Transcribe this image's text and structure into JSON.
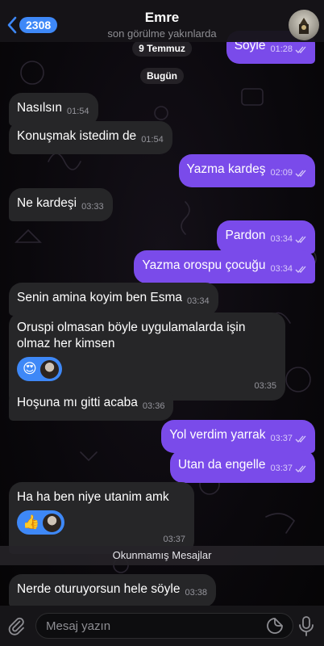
{
  "header": {
    "back_count": "2308",
    "title": "Emre",
    "subtitle": "son görülme yakınlarda"
  },
  "top_partial": {
    "date": "9 Temmuz",
    "text": "Söyle",
    "time": "01:28"
  },
  "date_today": "Bugün",
  "messages": [
    {
      "dir": "in",
      "text": "Nasılsın",
      "time": "01:54"
    },
    {
      "dir": "in",
      "text": "Konuşmak istedim de",
      "time": "01:54"
    },
    {
      "dir": "out",
      "text": "Yazma kardeş",
      "time": "02:09"
    },
    {
      "dir": "in",
      "text": "Ne kardeşi",
      "time": "03:33"
    },
    {
      "dir": "out",
      "text": "Pardon",
      "time": "03:34"
    },
    {
      "dir": "out",
      "text": "Yazma orospu çocuğu",
      "time": "03:34"
    },
    {
      "dir": "in",
      "text": "Senin amina koyim ben Esma",
      "time": "03:34"
    },
    {
      "dir": "in",
      "text": "Oruspi olmasan böyle uygulamalarda işin olmaz her kimsen",
      "time": "03:35",
      "reaction": "😍"
    },
    {
      "dir": "in",
      "text": "Hoşuna mı gitti acaba",
      "time": "03:36"
    },
    {
      "dir": "out",
      "text": "Yol verdim yarrak",
      "time": "03:37"
    },
    {
      "dir": "out",
      "text": "Utan da engelle",
      "time": "03:37"
    },
    {
      "dir": "in",
      "text": "Ha ha ben niye utanim amk",
      "time": "03:37",
      "reaction": "👍"
    },
    {
      "dir": "in",
      "text": "Nerde oturuyorsun hele söyle",
      "time": "03:38"
    }
  ],
  "unread_label": "Okunmamış Mesajlar",
  "input": {
    "placeholder": "Mesaj yazın"
  },
  "icons": [
    "chevron-left-icon",
    "paperclip-icon",
    "sticker-icon",
    "microphone-icon",
    "double-check-icon"
  ],
  "colors": {
    "accent": "#3e88f7",
    "outgoing_bubble": "#7a4bea",
    "incoming_bubble": "#262628"
  }
}
